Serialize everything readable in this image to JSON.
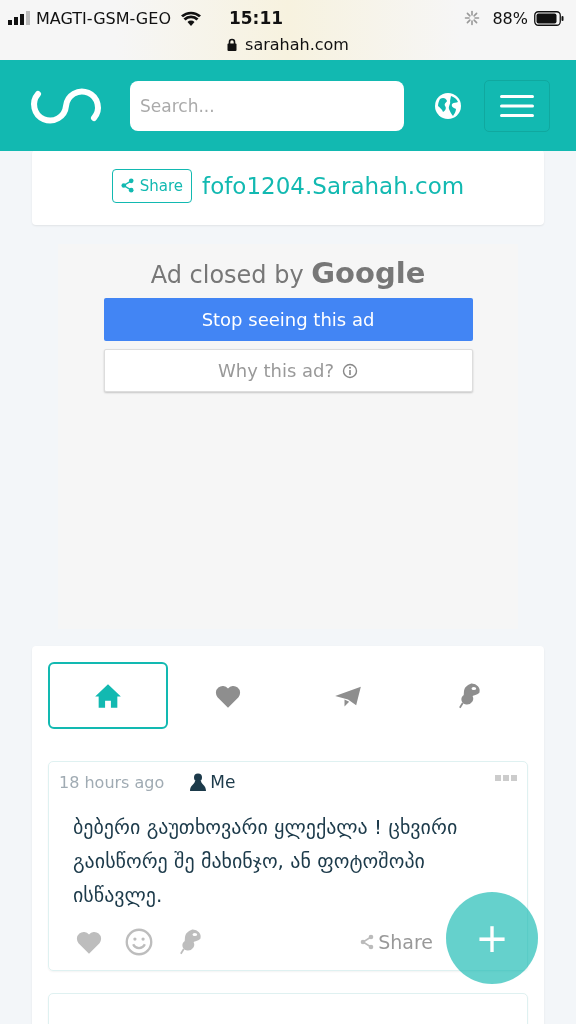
{
  "status_bar": {
    "carrier": "MAGTI-GSM-GEO",
    "time": "15:11",
    "battery": "88%"
  },
  "address_bar": {
    "url": "sarahah.com"
  },
  "header": {
    "search": {
      "placeholder": "Search..."
    }
  },
  "profile": {
    "share_label": "Share",
    "link": "fofo1204.Sarahah.com"
  },
  "ad": {
    "title": "Ad closed by",
    "brand": "Google",
    "buttons": [
      {
        "label": "Stop seeing this ad",
        "kind": "primary"
      },
      {
        "label": "Why this ad?",
        "kind": "info"
      }
    ]
  },
  "tabs": [
    {
      "kind": "home",
      "selected": true
    },
    {
      "kind": "heart",
      "selected": false
    },
    {
      "kind": "plane",
      "selected": false
    },
    {
      "kind": "pin",
      "selected": false
    }
  ],
  "messages": [
    {
      "time": "18 hours ago",
      "author": "Me",
      "text": "ბებერი გაუთხოვარი ყლექალა ! ცხვირი გაისწორე შე მახინჯო, ან ფოტოშოპი ისწავლე.",
      "share_label": "Share"
    }
  ],
  "fab": {
    "label": "+"
  }
}
